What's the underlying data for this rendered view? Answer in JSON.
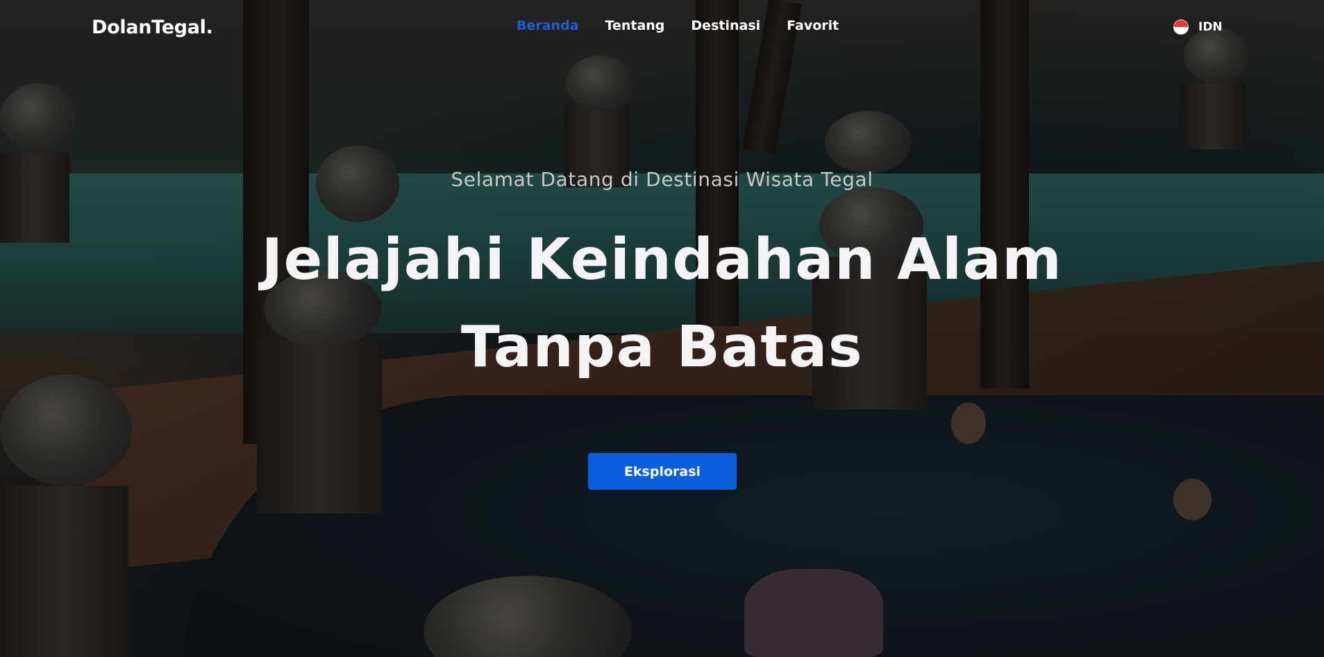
{
  "navbar": {
    "logo": "DolanTegal.",
    "links": [
      {
        "label": "Beranda",
        "active": true
      },
      {
        "label": "Tentang",
        "active": false
      },
      {
        "label": "Destinasi",
        "active": false
      },
      {
        "label": "Favorit",
        "active": false
      }
    ],
    "language": {
      "label": "IDN",
      "flag_icon": "indonesia-flag-icon"
    }
  },
  "hero": {
    "subtitle": "Selamat Datang di Destinasi Wisata Tegal",
    "headline_line1": "Jelajahi Keindahan Alam",
    "headline_line2": "Tanpa Batas",
    "cta_label": "Eksplorasi"
  },
  "colors": {
    "accent": "#0b5ee0",
    "active_link": "#1f5fd1",
    "text": "#ffffff"
  }
}
